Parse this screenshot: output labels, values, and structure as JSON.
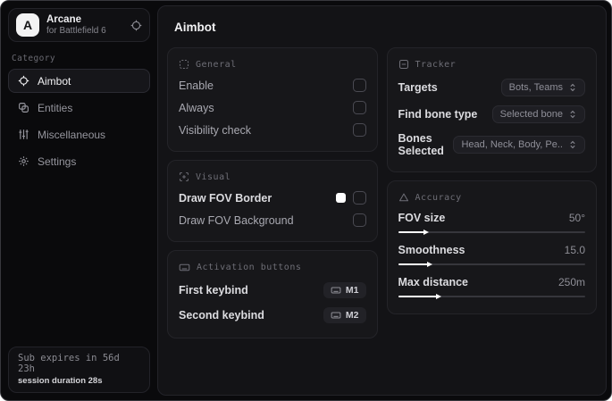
{
  "sidebar": {
    "brand": {
      "initial": "A",
      "name": "Arcane",
      "subtitle": "for Battlefield 6"
    },
    "category_label": "Category",
    "items": [
      {
        "label": "Aimbot",
        "icon": "crosshair-icon",
        "active": true
      },
      {
        "label": "Entities",
        "icon": "entities-icon",
        "active": false
      },
      {
        "label": "Miscellaneous",
        "icon": "sliders-icon",
        "active": false
      },
      {
        "label": "Settings",
        "icon": "gear-icon",
        "active": false
      }
    ],
    "footer": {
      "sub_expires": "Sub expires in 56d 23h",
      "session_duration": "session duration 28s"
    }
  },
  "main": {
    "title": "Aimbot",
    "general": {
      "header": "General",
      "rows": [
        {
          "label": "Enable",
          "checked": false
        },
        {
          "label": "Always",
          "checked": false
        },
        {
          "label": "Visibility check",
          "checked": false
        }
      ]
    },
    "visual": {
      "header": "Visual",
      "rows": [
        {
          "label": "Draw FOV Border",
          "swatch_color": "#ffffff",
          "checked": false
        },
        {
          "label": "Draw FOV Background",
          "checked": false
        }
      ]
    },
    "activation": {
      "header": "Activation buttons",
      "rows": [
        {
          "label": "First keybind",
          "key": "M1"
        },
        {
          "label": "Second keybind",
          "key": "M2"
        }
      ]
    },
    "tracker": {
      "header": "Tracker",
      "rows": [
        {
          "label": "Targets",
          "value": "Bots, Teams"
        },
        {
          "label": "Find bone type",
          "value": "Selected bone"
        },
        {
          "label": "Bones Selected",
          "value": "Head, Neck, Body, Pe.."
        }
      ]
    },
    "accuracy": {
      "header": "Accuracy",
      "sliders": [
        {
          "label": "FOV size",
          "value": "50°",
          "fill_percent": 14
        },
        {
          "label": "Smoothness",
          "value": "15.0",
          "fill_percent": 16
        },
        {
          "label": "Max distance",
          "value": "250m",
          "fill_percent": 21
        }
      ]
    }
  }
}
